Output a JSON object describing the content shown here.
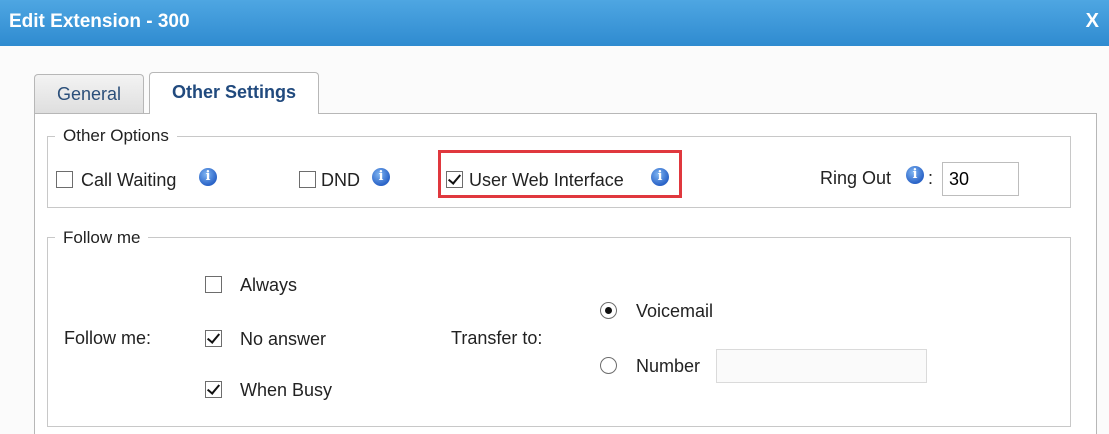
{
  "window": {
    "title": "Edit Extension - 300",
    "close_label": "X"
  },
  "tabs": [
    {
      "label": "General",
      "active": false
    },
    {
      "label": "Other Settings",
      "active": true
    }
  ],
  "other_options": {
    "legend": "Other Options",
    "call_waiting": {
      "label": "Call Waiting",
      "checked": false
    },
    "dnd": {
      "label": "DND",
      "checked": false
    },
    "user_web_interface": {
      "label": "User Web Interface",
      "checked": true
    },
    "ring_out": {
      "label": "Ring Out",
      "colon": ":",
      "value": "30"
    }
  },
  "follow_me": {
    "legend": "Follow me",
    "row_label": "Follow me:",
    "options": [
      {
        "label": "Always",
        "checked": false
      },
      {
        "label": "No answer",
        "checked": true
      },
      {
        "label": "When Busy",
        "checked": true
      }
    ],
    "transfer_label": "Transfer to:",
    "transfer_options": [
      {
        "label": "Voicemail",
        "selected": true
      },
      {
        "label": "Number",
        "selected": false
      }
    ],
    "number_value": ""
  },
  "icons": {
    "info": "info-icon",
    "close": "close-icon"
  },
  "colors": {
    "titlebar": "#3a96d8",
    "tab_active_text": "#214a7e",
    "highlight": "#e0383e"
  }
}
